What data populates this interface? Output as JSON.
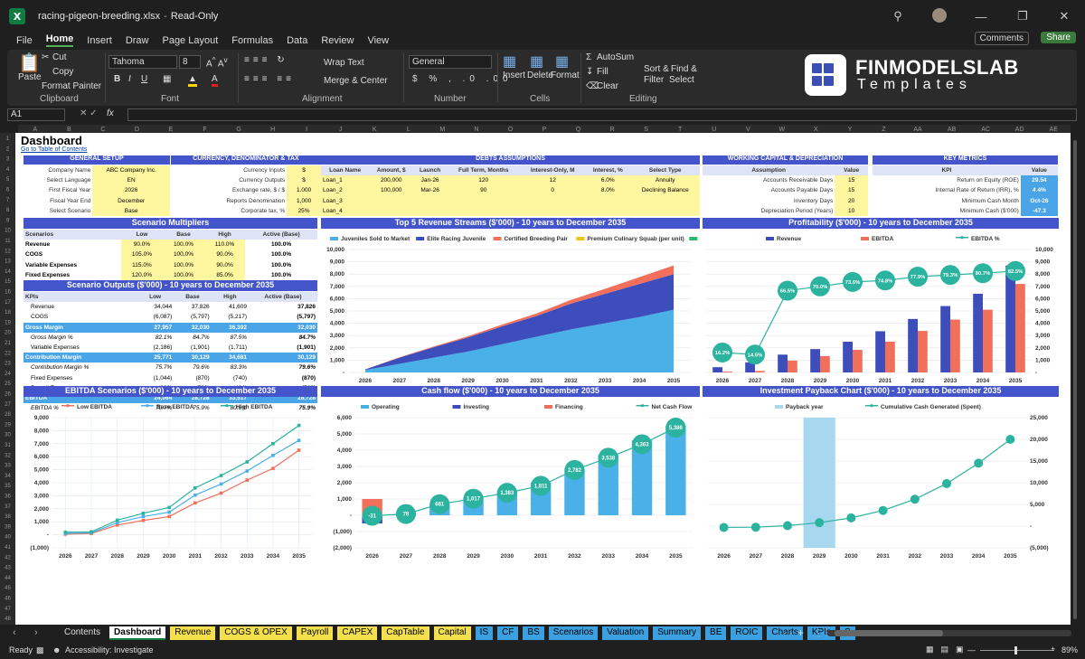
{
  "window": {
    "file_name": "racing-pigeon-breeding.xlsx",
    "mode": "Read-Only"
  },
  "menu": [
    "File",
    "Home",
    "Insert",
    "Draw",
    "Page Layout",
    "Formulas",
    "Data",
    "Review",
    "View"
  ],
  "menu_active": "Home",
  "header_buttons": {
    "comments": "Comments",
    "share": "Share"
  },
  "ribbon": {
    "clipboard": {
      "paste": "Paste",
      "cut": "Cut",
      "copy": "Copy",
      "format_painter": "Format Painter",
      "group": "Clipboard"
    },
    "font": {
      "name": "Tahoma",
      "size": "8",
      "group": "Font"
    },
    "alignment": {
      "wrap": "Wrap Text",
      "merge": "Merge & Center",
      "group": "Alignment"
    },
    "number": {
      "format": "General",
      "group": "Number"
    },
    "cells": {
      "insert": "Insert",
      "delete": "Delete",
      "format": "Format",
      "group": "Cells"
    },
    "editing": {
      "autosum": "AutoSum",
      "fill": "Fill",
      "clear": "Clear",
      "sort": "Sort &",
      "filter": "Filter",
      "find": "Find &",
      "select": "Select",
      "group": "Editing"
    }
  },
  "brand": {
    "line1": "FINMODELSLAB",
    "line2": "Templates"
  },
  "formula_bar": {
    "cell": "A1",
    "fx": "fx"
  },
  "columns": [
    "A",
    "B",
    "C",
    "D",
    "E",
    "F",
    "G",
    "H",
    "I",
    "J",
    "K",
    "L",
    "M",
    "N",
    "O",
    "P",
    "Q",
    "R",
    "S",
    "T",
    "U",
    "V",
    "W",
    "X",
    "Y",
    "Z",
    "AA",
    "AB",
    "AC",
    "AD",
    "AE"
  ],
  "sheet": {
    "title": "Dashboard",
    "toc_link": "Go to Table of Contents",
    "general_setup": {
      "title": "GENERAL SETUP",
      "rows": [
        [
          "Company Name",
          "ABC Company Inc."
        ],
        [
          "Select Language",
          "EN"
        ],
        [
          "First Fiscal Year",
          "2026"
        ],
        [
          "Fiscal Year End",
          "December"
        ],
        [
          "Select Scenario",
          "Base"
        ]
      ]
    },
    "currency": {
      "title": "CURRENCY, DENOMINATOR & TAX",
      "rows": [
        [
          "Currency Inputs",
          "$"
        ],
        [
          "Currency Outputs",
          "$"
        ],
        [
          "Exchange rate, $ / $",
          "1.000"
        ],
        [
          "Reports Denomination",
          "1,000"
        ],
        [
          "Corporate tax, %",
          "25%"
        ]
      ]
    },
    "debts": {
      "title": "DEBTS ASSUMPTIONS",
      "headers": [
        "Loan Name",
        "Amount, $",
        "Launch",
        "Full Term, Months",
        "Interest-Only, M",
        "Interest, %",
        "Select Type"
      ],
      "rows": [
        [
          "Loan_1",
          "200,000",
          "Jan-26",
          "120",
          "12",
          "6.0%",
          "Annuity"
        ],
        [
          "Loan_2",
          "100,000",
          "Mar-26",
          "90",
          "0",
          "8.0%",
          "Declining Balance"
        ],
        [
          "Loan_3",
          "",
          "",
          "",
          "",
          "",
          ""
        ],
        [
          "Loan_4",
          "",
          "",
          "",
          "",
          "",
          ""
        ]
      ]
    },
    "working_capital": {
      "title": "WORKING CAPITAL & DEPRECIATION",
      "headers": [
        "Assumption",
        "Value"
      ],
      "rows": [
        [
          "Accounts Receivable Days",
          "15"
        ],
        [
          "Accounts Payable Days",
          "15"
        ],
        [
          "Inventory Days",
          "20"
        ],
        [
          "Depreciation Period (Years)",
          "10"
        ]
      ]
    },
    "key_metrics": {
      "title": "KEY METRICS",
      "headers": [
        "KPI",
        "Value"
      ],
      "rows": [
        [
          "Return on Equity (ROE)",
          "29.54"
        ],
        [
          "Internal Rate of Return (IRR), %",
          "4.4%"
        ],
        [
          "Minimum Cash Month",
          "Oct-26"
        ],
        [
          "Minimum Cash ($'000)",
          "-47.3"
        ]
      ]
    },
    "scenario_multipliers": {
      "title": "Scenario Multipliers",
      "headers": [
        "Scenarios",
        "Low",
        "Base",
        "High",
        "Active (Base)"
      ],
      "rows": [
        [
          "Revenue",
          "90.0%",
          "100.0%",
          "110.0%",
          "100.0%"
        ],
        [
          "COGS",
          "105.0%",
          "100.0%",
          "90.0%",
          "100.0%"
        ],
        [
          "Variable Expenses",
          "115.0%",
          "100.0%",
          "90.0%",
          "100.0%"
        ],
        [
          "Fixed Expenses",
          "120.0%",
          "100.0%",
          "85.0%",
          "100.0%"
        ],
        [
          "Payroll Expenses",
          "125.0%",
          "100.0%",
          "75.0%",
          "100.0%"
        ]
      ]
    },
    "scenario_outputs": {
      "title": "Scenario Outputs ($'000) - 10 years to December 2035",
      "headers": [
        "KPIs",
        "Low",
        "Base",
        "High",
        "Active (Base)"
      ],
      "rows": [
        [
          "Revenue",
          "34,044",
          "37,826",
          "41,609",
          "37,826"
        ],
        [
          "COGS",
          "(6,087)",
          "(5,797)",
          "(5,217)",
          "(5,797)"
        ],
        [
          "Gross Margin",
          "27,957",
          "32,030",
          "36,392",
          "32,030"
        ],
        [
          "Gross Margin %",
          "82.1%",
          "84.7%",
          "87.5%",
          "84.7%"
        ],
        [
          "Variable Expenses",
          "(2,186)",
          "(1,901)",
          "(1,711)",
          "(1,901)"
        ],
        [
          "Contribution Margin",
          "25,771",
          "30,129",
          "34,681",
          "30,129"
        ],
        [
          "Contribution Margin %",
          "75.7%",
          "79.6%",
          "83.3%",
          "79.6%"
        ],
        [
          "Fixed Expenses",
          "(1,044)",
          "(870)",
          "(740)",
          "(870)"
        ],
        [
          "Payroll Expenses",
          "(663)",
          "(530)",
          "(424)",
          "(530)"
        ],
        [
          "EBITDA",
          "24,064",
          "28,728",
          "33,517",
          "28,728"
        ],
        [
          "EBITDA %",
          "70.7%",
          "75.9%",
          "80.6%",
          "75.9%"
        ]
      ]
    }
  },
  "chart_titles": {
    "revenue": "Top 5 Revenue Streams ($'000) - 10 years to December 2035",
    "profitability": "Profitability ($'000) - 10 years to December 2035",
    "ebitda": "EBITDA Scenarios ($'000) - 10 years to December 2035",
    "cashflow": "Cash flow ($'000) - 10 years to December 2035",
    "payback": "Investment Payback Chart ($'000) - 10 years to December 2035"
  },
  "chart_data": [
    {
      "id": "revenue",
      "type": "area",
      "title": "Top 5 Revenue Streams ($'000) - 10 years to December 2035",
      "categories": [
        "2026",
        "2027",
        "2028",
        "2029",
        "2030",
        "2031",
        "2032",
        "2033",
        "2034",
        "2035"
      ],
      "series": [
        {
          "name": "Juveniles Sold to Market",
          "values": [
            200,
            700,
            1200,
            1700,
            2300,
            2900,
            3500,
            4000,
            4500,
            5100
          ],
          "color": "#4ab0e8"
        },
        {
          "name": "Elite Racing Juvenile",
          "values": [
            50,
            500,
            850,
            1150,
            1450,
            1700,
            2100,
            2400,
            2700,
            2900
          ],
          "color": "#3d4dbb"
        },
        {
          "name": "Certified Breeding Pair",
          "values": [
            10,
            30,
            60,
            100,
            150,
            200,
            300,
            400,
            550,
            700
          ],
          "color": "#f26f5c"
        },
        {
          "name": "Premium Culinary Squab (per unit)",
          "values": [
            0,
            0,
            0,
            0,
            0,
            0,
            0,
            0,
            0,
            0
          ],
          "color": "#f0c419"
        },
        {
          "name": "Other Revenue",
          "values": [
            0,
            0,
            0,
            0,
            0,
            0,
            0,
            0,
            0,
            0
          ],
          "color": "#2bb673"
        }
      ],
      "ylim": [
        0,
        10000
      ],
      "yticks": [
        "-",
        "1,000",
        "2,000",
        "3,000",
        "4,000",
        "5,000",
        "6,000",
        "7,000",
        "8,000",
        "9,000",
        "10,000"
      ]
    },
    {
      "id": "profitability",
      "type": "bar",
      "title": "Profitability ($'000) - 10 years to December 2035",
      "categories": [
        "2026",
        "2027",
        "2028",
        "2029",
        "2030",
        "2031",
        "2032",
        "2033",
        "2034",
        "2035"
      ],
      "series": [
        {
          "name": "Revenue",
          "values": [
            430,
            820,
            1450,
            1900,
            2500,
            3350,
            4350,
            5400,
            6400,
            8700
          ],
          "color": "#3d4dbb"
        },
        {
          "name": "EBITDA",
          "values": [
            70,
            120,
            960,
            1330,
            1840,
            2500,
            3380,
            4300,
            5100,
            7200
          ],
          "color": "#f26f5c"
        },
        {
          "name": "EBITDA %",
          "values": [
            16.2,
            14.5,
            66.5,
            70.0,
            73.6,
            74.8,
            77.9,
            79.3,
            80.7,
            82.5
          ],
          "color": "#2bb3a0",
          "labels": [
            "16.2%",
            "14.5%",
            "66.5%",
            "70.0%",
            "73.6%",
            "74.8%",
            "77.9%",
            "79.3%",
            "80.7%",
            "82.5%"
          ]
        }
      ],
      "ylim": [
        0,
        10000
      ],
      "yticks": [
        "-",
        "1,000",
        "2,000",
        "3,000",
        "4,000",
        "5,000",
        "6,000",
        "7,000",
        "8,000",
        "9,000",
        "10,000"
      ]
    },
    {
      "id": "ebitda",
      "type": "line",
      "title": "EBITDA Scenarios ($'000) - 10 years to December 2035",
      "categories": [
        "2026",
        "2027",
        "2028",
        "2029",
        "2030",
        "2031",
        "2032",
        "2033",
        "2034",
        "2035"
      ],
      "series": [
        {
          "name": "Low EBITDA",
          "values": [
            50,
            100,
            750,
            1100,
            1400,
            2450,
            3200,
            4200,
            5100,
            6500
          ],
          "color": "#f26f5c"
        },
        {
          "name": "Base EBITDA",
          "values": [
            100,
            150,
            930,
            1400,
            1740,
            3050,
            3900,
            4900,
            6100,
            7250
          ],
          "color": "#4ab0e8"
        },
        {
          "name": "High EBITDA",
          "values": [
            200,
            230,
            1120,
            1650,
            2100,
            3600,
            4550,
            5600,
            7000,
            8400
          ],
          "color": "#2bb3a0"
        }
      ],
      "ylim": [
        -1000,
        9000
      ],
      "yticks": [
        "(1,000)",
        "-",
        "1,000",
        "2,000",
        "3,000",
        "4,000",
        "5,000",
        "6,000",
        "7,000",
        "8,000",
        "9,000"
      ]
    },
    {
      "id": "cashflow",
      "type": "bar",
      "title": "Cash flow ($'000) - 10 years to December 2035",
      "categories": [
        "2026",
        "2027",
        "2028",
        "2029",
        "2030",
        "2031",
        "2032",
        "2033",
        "2034",
        "2035"
      ],
      "series": [
        {
          "name": "Operating",
          "values": [
            -80,
            170,
            700,
            1100,
            1500,
            2000,
            2850,
            3700,
            4600,
            5500
          ],
          "color": "#4ab0e8"
        },
        {
          "name": "Investing",
          "values": [
            -420,
            0,
            0,
            0,
            0,
            0,
            0,
            0,
            0,
            0
          ],
          "color": "#3d4dbb"
        },
        {
          "name": "Financing",
          "values": [
            1000,
            0,
            0,
            0,
            0,
            0,
            0,
            0,
            0,
            0
          ],
          "color": "#f26f5c"
        },
        {
          "name": "Net Cash Flow",
          "values": [
            -31,
            78,
            681,
            1017,
            1383,
            1811,
            2782,
            3538,
            4363,
            5386
          ],
          "color": "#2bb3a0",
          "labels": [
            "-31",
            "78",
            "681",
            "1,017",
            "1,383",
            "1,811",
            "2,782",
            "3,538",
            "4,363",
            "5,386"
          ]
        }
      ],
      "ylim": [
        -2000,
        6000
      ],
      "yticks": [
        "(2,000)",
        "(1,000)",
        "-",
        "1,000",
        "2,000",
        "3,000",
        "4,000",
        "5,000",
        "6,000"
      ]
    },
    {
      "id": "payback",
      "type": "line",
      "title": "Investment Payback Chart ($'000) - 10 years to December 2035",
      "categories": [
        "2026",
        "2027",
        "2028",
        "2029",
        "2030",
        "2031",
        "2032",
        "2033",
        "2034",
        "2035"
      ],
      "series": [
        {
          "name": "Payback year",
          "values": [
            0,
            0,
            0,
            1,
            0,
            0,
            0,
            0,
            0,
            0
          ],
          "color": "#a8d8f0"
        },
        {
          "name": "Cumulative Cash Generated (Spent)",
          "values": [
            -300,
            -250,
            100,
            800,
            1900,
            3600,
            6200,
            9800,
            14500,
            20000
          ],
          "color": "#2bb3a0"
        }
      ],
      "ylim": [
        -5000,
        25000
      ],
      "yticks": [
        "(5,000)",
        "-",
        "5,000",
        "10,000",
        "15,000",
        "20,000",
        "25,000"
      ]
    }
  ],
  "sheet_tabs": [
    {
      "label": "Contents",
      "color": "#1f1f1f",
      "text": "#ddd"
    },
    {
      "label": "Dashboard",
      "color": "#ffffff",
      "text": "#000",
      "active": true
    },
    {
      "label": "Revenue",
      "color": "#f4e04d",
      "text": "#000"
    },
    {
      "label": "COGS & OPEX",
      "color": "#f4e04d",
      "text": "#000"
    },
    {
      "label": "Payroll",
      "color": "#f4e04d",
      "text": "#000"
    },
    {
      "label": "CAPEX",
      "color": "#f4e04d",
      "text": "#000"
    },
    {
      "label": "CapTable",
      "color": "#f4e04d",
      "text": "#000"
    },
    {
      "label": "Capital",
      "color": "#f4e04d",
      "text": "#000"
    },
    {
      "label": "IS",
      "color": "#3ba0e0",
      "text": "#000"
    },
    {
      "label": "CF",
      "color": "#3ba0e0",
      "text": "#000"
    },
    {
      "label": "BS",
      "color": "#3ba0e0",
      "text": "#000"
    },
    {
      "label": "Scenarios",
      "color": "#3ba0e0",
      "text": "#000"
    },
    {
      "label": "Valuation",
      "color": "#3ba0e0",
      "text": "#000"
    },
    {
      "label": "Summary",
      "color": "#3ba0e0",
      "text": "#000"
    },
    {
      "label": "BE",
      "color": "#3ba0e0",
      "text": "#000"
    },
    {
      "label": "ROIC",
      "color": "#3ba0e0",
      "text": "#000"
    },
    {
      "label": "Charts",
      "color": "#3ba0e0",
      "text": "#000"
    },
    {
      "label": "KPIs",
      "color": "#3ba0e0",
      "text": "#000"
    },
    {
      "label": "S",
      "color": "#3ba0e0",
      "text": "#000"
    }
  ],
  "status": {
    "ready": "Ready",
    "accessibility": "Accessibility: Investigate",
    "zoom": "89%"
  }
}
